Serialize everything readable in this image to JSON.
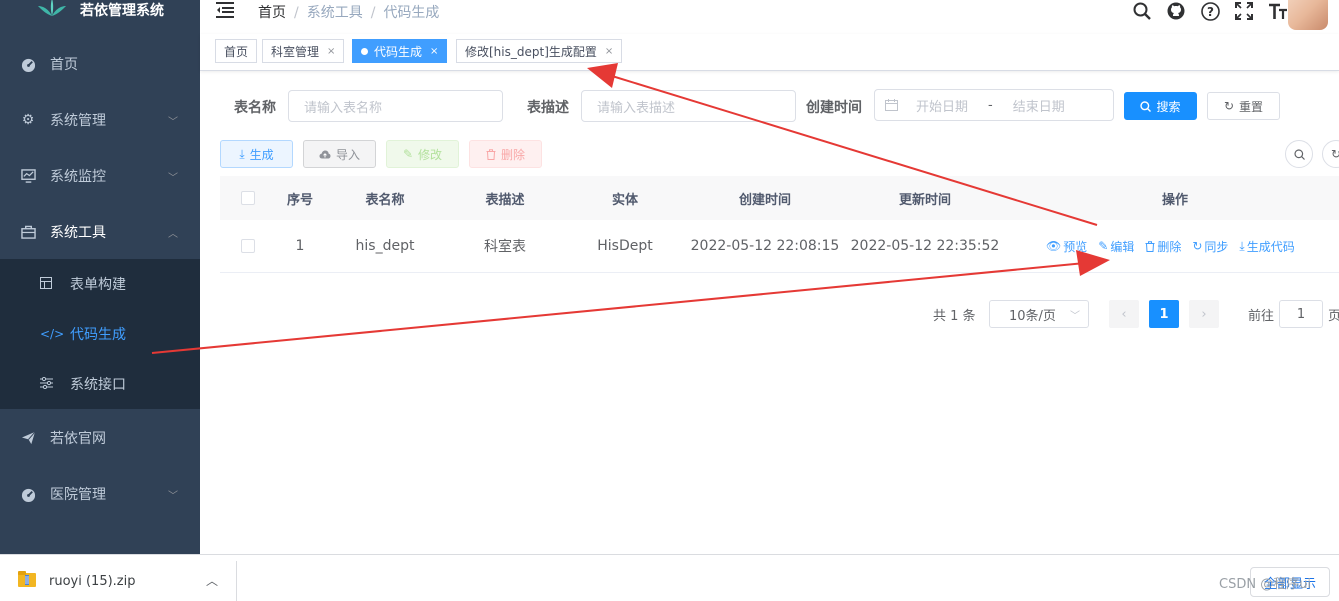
{
  "app": {
    "title": "若依管理系统"
  },
  "sidebar": {
    "items": [
      {
        "label": "首页",
        "icon": "dashboard-icon"
      },
      {
        "label": "系统管理",
        "icon": "gear-icon"
      },
      {
        "label": "系统监控",
        "icon": "monitor-icon"
      },
      {
        "label": "系统工具",
        "icon": "toolbox-icon"
      },
      {
        "label": "若依官网",
        "icon": "paper-plane-icon"
      },
      {
        "label": "医院管理",
        "icon": "dashboard-icon"
      }
    ],
    "submenu": [
      {
        "label": "表单构建",
        "icon": "form-grid-icon"
      },
      {
        "label": "代码生成",
        "icon": "code-icon",
        "active": true
      },
      {
        "label": "系统接口",
        "icon": "sliders-icon"
      }
    ]
  },
  "breadcrumb": [
    "首页",
    "系统工具",
    "代码生成"
  ],
  "tags": [
    {
      "label": "首页"
    },
    {
      "label": "科室管理"
    },
    {
      "label": "代码生成",
      "active": true
    },
    {
      "label": "修改[his_dept]生成配置"
    }
  ],
  "search": {
    "table_name_label": "表名称",
    "table_name_placeholder": "请输入表名称",
    "table_desc_label": "表描述",
    "table_desc_placeholder": "请输入表描述",
    "create_time_label": "创建时间",
    "start_placeholder": "开始日期",
    "range_sep": "-",
    "end_placeholder": "结束日期",
    "search_btn": "搜索",
    "reset_btn": "重置"
  },
  "toolbar": {
    "generate": "生成",
    "import": "导入",
    "modify": "修改",
    "delete": "删除"
  },
  "table": {
    "columns": [
      "序号",
      "表名称",
      "表描述",
      "实体",
      "创建时间",
      "更新时间",
      "操作"
    ],
    "rows": [
      {
        "index": "1",
        "table_name": "his_dept",
        "table_desc": "科室表",
        "entity": "HisDept",
        "create_time": "2022-05-12 22:08:15",
        "update_time": "2022-05-12 22:35:52"
      }
    ],
    "operations": [
      "预览",
      "编辑",
      "删除",
      "同步",
      "生成代码"
    ]
  },
  "pagination": {
    "total": "共 1 条",
    "page_size": "10条/页",
    "current": "1",
    "goto_label": "前往",
    "goto_value": "1",
    "page_suffix": "页"
  },
  "download_bar": {
    "file_name": "ruoyi (15).zip",
    "show_all": "全部显示"
  },
  "watermark": "CSDN @程序ui",
  "colors": {
    "sidebar_bg": "#304156",
    "submenu_bg": "#1f2d3d",
    "primary": "#1890ff",
    "active_link": "#409eff",
    "annotation_arrow": "#e53935"
  }
}
